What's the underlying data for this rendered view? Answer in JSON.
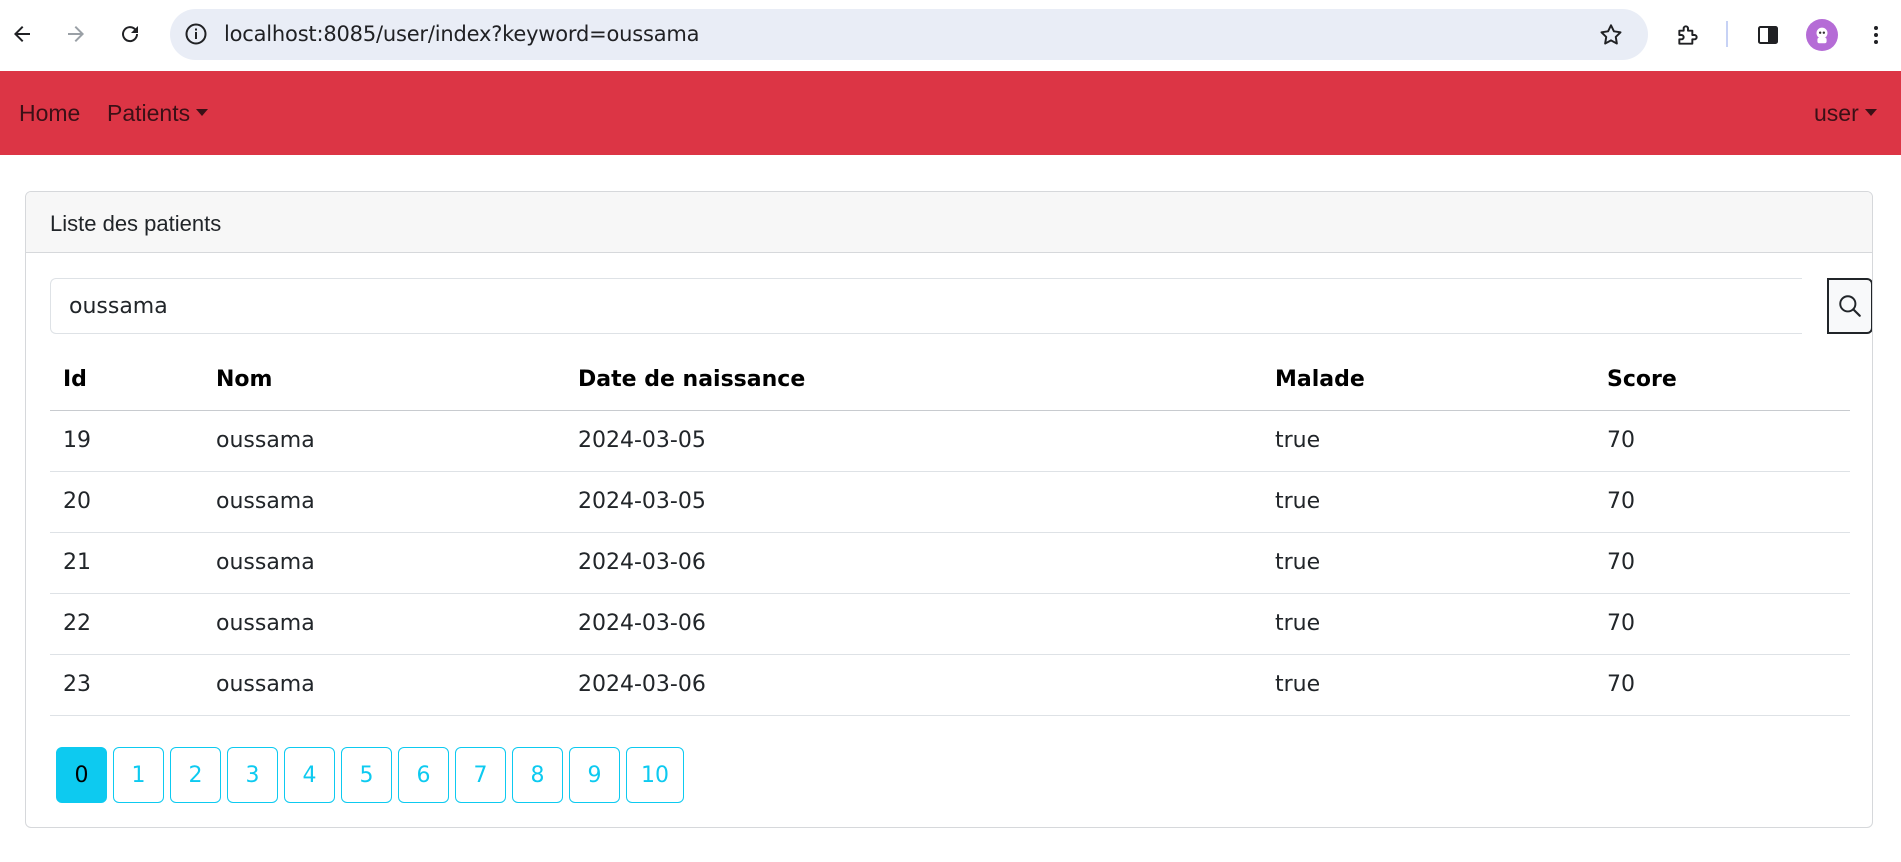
{
  "browser": {
    "url": "localhost:8085/user/index?keyword=oussama",
    "icons": [
      "back-arrow-icon",
      "forward-arrow-icon",
      "reload-icon",
      "info-icon",
      "star-icon",
      "extensions-icon",
      "side-panel-icon",
      "profile-avatar",
      "kebab-menu-icon"
    ]
  },
  "navbar": {
    "home": "Home",
    "patients": "Patients",
    "user": "user",
    "bg_color": "#dc3545"
  },
  "card": {
    "header": "Liste des patients",
    "search_value": "oussama",
    "columns": [
      "Id",
      "Nom",
      "Date de naissance",
      "Malade",
      "Score"
    ],
    "rows": [
      [
        "19",
        "oussama",
        "2024-03-05",
        "true",
        "70"
      ],
      [
        "20",
        "oussama",
        "2024-03-05",
        "true",
        "70"
      ],
      [
        "21",
        "oussama",
        "2024-03-06",
        "true",
        "70"
      ],
      [
        "22",
        "oussama",
        "2024-03-06",
        "true",
        "70"
      ],
      [
        "23",
        "oussama",
        "2024-03-06",
        "true",
        "70"
      ]
    ],
    "pages": [
      "0",
      "1",
      "2",
      "3",
      "4",
      "5",
      "6",
      "7",
      "8",
      "9",
      "10"
    ],
    "active_page": "0",
    "accent_color": "#0dcaf0"
  }
}
